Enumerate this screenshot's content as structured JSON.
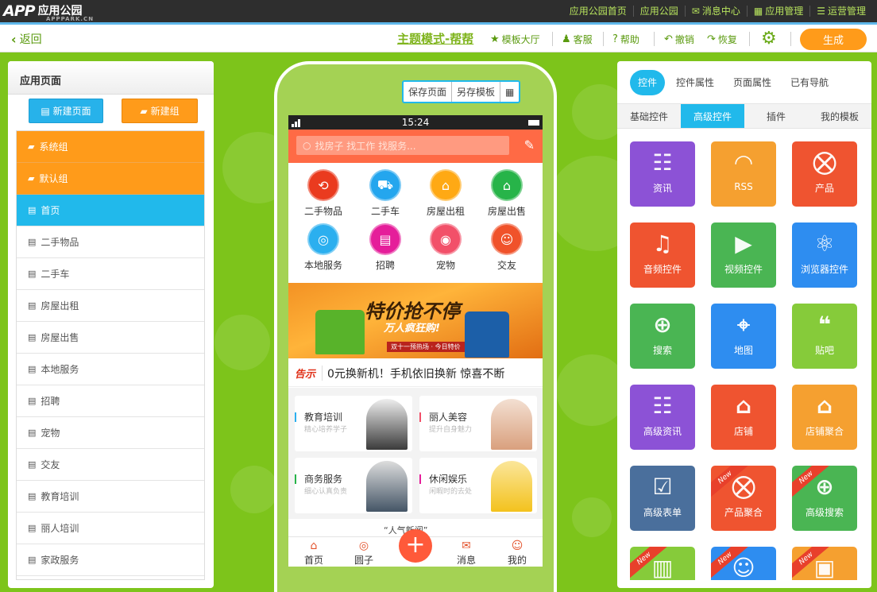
{
  "topbar": {
    "logo_mark": "APP",
    "logo_name": "应用公园",
    "logo_sub": "APPPARK.CN",
    "nav": [
      {
        "label": "应用公园首页",
        "icon": ""
      },
      {
        "label": "应用公园",
        "icon": ""
      },
      {
        "label": "消息中心",
        "icon": "✉"
      },
      {
        "label": "应用管理",
        "icon": "▦"
      },
      {
        "label": "运营管理",
        "icon": "☰"
      }
    ]
  },
  "toolbar": {
    "back": "返回",
    "mode_title": "主题模式-帮帮",
    "template_hall": "模板大厅",
    "support": "客服",
    "help": "帮助",
    "undo": "撤销",
    "redo": "恢复",
    "generate": "生成"
  },
  "left": {
    "title": "应用页面",
    "new_page": "新建页面",
    "new_group": "新建组",
    "groups": [
      "系统组",
      "默认组"
    ],
    "pages": [
      "首页",
      "二手物品",
      "二手车",
      "房屋出租",
      "房屋出售",
      "本地服务",
      "招聘",
      "宠物",
      "交友",
      "教育培训",
      "丽人培训",
      "家政服务"
    ]
  },
  "phone": {
    "save": "保存页面",
    "save_as_template": "另存模板",
    "qr": "▦",
    "time": "15:24",
    "search_placeholder": "找房子 找工作 找服务...",
    "icons": [
      {
        "label": "二手物品",
        "color": "#ea3b1f",
        "glyph": "⟲"
      },
      {
        "label": "二手车",
        "color": "#24a6ee",
        "glyph": "⛟"
      },
      {
        "label": "房屋出租",
        "color": "#ffa914",
        "glyph": "⌂"
      },
      {
        "label": "房屋出售",
        "color": "#27b449",
        "glyph": "⌂"
      },
      {
        "label": "本地服务",
        "color": "#2bafef",
        "glyph": "◎"
      },
      {
        "label": "招聘",
        "color": "#e51e9a",
        "glyph": "▤"
      },
      {
        "label": "宠物",
        "color": "#f25069",
        "glyph": "◉"
      },
      {
        "label": "交友",
        "color": "#f0522a",
        "glyph": "☺"
      }
    ],
    "banner_title": "特价抢不停",
    "banner_sub": "万人疯狂购!",
    "banner_tag": "双十一预热场 · 今日特价",
    "notice_tag": "告示",
    "notice_text": "0元换新机！手机依旧换新 惊喜不断",
    "cards": [
      {
        "title": "教育培训",
        "sub": "精心培养学子",
        "color": "#2bafef",
        "pic": "#3b3b3b"
      },
      {
        "title": "丽人美容",
        "sub": "提升自身魅力",
        "color": "#f25069",
        "pic": "#d9a07d"
      },
      {
        "title": "商务服务",
        "sub": "细心认真负责",
        "color": "#27b449",
        "pic": "#445566"
      },
      {
        "title": "休闲娱乐",
        "sub": "闲暇时的去处",
        "color": "#e51e9a",
        "pic": "#f3c21d"
      }
    ],
    "partial_title": "“人气新闻”",
    "bottom_nav": [
      {
        "label": "首页",
        "glyph": "⌂"
      },
      {
        "label": "圆子",
        "glyph": "◎"
      },
      {
        "label": "消息",
        "glyph": "✉"
      },
      {
        "label": "我的",
        "glyph": "☺"
      }
    ],
    "plus": "+"
  },
  "right": {
    "tabs": [
      "控件",
      "控件属性",
      "页面属性",
      "已有导航"
    ],
    "subtabs": [
      "基础控件",
      "高级控件",
      "插件",
      "我的模板"
    ],
    "tiles": [
      {
        "label": "资讯",
        "color": "#8c52d6",
        "glyph": "☷",
        "new": false
      },
      {
        "label": "RSS",
        "color": "#f5a030",
        "glyph": "◠",
        "new": false
      },
      {
        "label": "产品",
        "color": "#ef5430",
        "glyph": "⛒",
        "new": false
      },
      {
        "label": "音频控件",
        "color": "#ef5430",
        "glyph": "♫",
        "new": false
      },
      {
        "label": "视频控件",
        "color": "#4ab553",
        "glyph": "▶",
        "new": false
      },
      {
        "label": "浏览器控件",
        "color": "#2e8df0",
        "glyph": "⚛",
        "new": false
      },
      {
        "label": "搜索",
        "color": "#4ab553",
        "glyph": "⊕",
        "new": false
      },
      {
        "label": "地图",
        "color": "#2e8df0",
        "glyph": "⌖",
        "new": false
      },
      {
        "label": "贴吧",
        "color": "#86cb3a",
        "glyph": "❝",
        "new": false
      },
      {
        "label": "高级资讯",
        "color": "#8c52d6",
        "glyph": "☷",
        "new": false
      },
      {
        "label": "店铺",
        "color": "#ef5430",
        "glyph": "⌂",
        "new": false
      },
      {
        "label": "店铺聚合",
        "color": "#f5a030",
        "glyph": "⌂",
        "new": false
      },
      {
        "label": "高级表单",
        "color": "#4a6f9c",
        "glyph": "☑",
        "new": false
      },
      {
        "label": "产品聚合",
        "color": "#ef5430",
        "glyph": "⛒",
        "new": true
      },
      {
        "label": "高级搜索",
        "color": "#4ab553",
        "glyph": "⊕",
        "new": true
      },
      {
        "label": "",
        "color": "#86cb3a",
        "glyph": "▥",
        "new": true
      },
      {
        "label": "",
        "color": "#2e8df0",
        "glyph": "☺",
        "new": true
      },
      {
        "label": "",
        "color": "#f5a030",
        "glyph": "▣",
        "new": true
      }
    ],
    "new_label": "New"
  }
}
